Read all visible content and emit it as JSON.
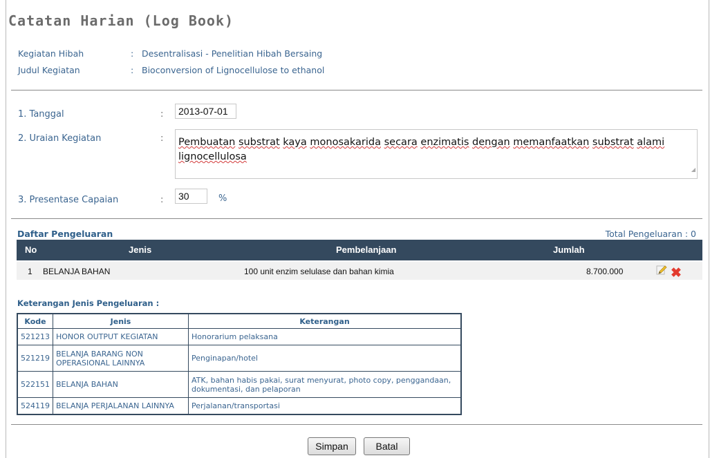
{
  "page": {
    "title": "Catatan Harian (Log Book)"
  },
  "info": {
    "hibah_label": "Kegiatan Hibah",
    "hibah_sep": ":",
    "hibah_value": "Desentralisasi - Penelitian Hibah Bersaing",
    "judul_label": "Judul Kegiatan",
    "judul_sep": ":",
    "judul_value": "Bioconversion of Lignocellulose to ethanol"
  },
  "form": {
    "tanggal_label": "1. Tanggal",
    "tanggal_value": "2013-07-01",
    "uraian_label": "2. Uraian Kegiatan",
    "uraian_words": [
      "Pembuatan",
      "substrat",
      "kaya",
      "monosakarida",
      "secara",
      "enzimatis",
      "dengan",
      "memanfaatkan",
      "substrat",
      "alami",
      "lignocellulosa"
    ],
    "presentase_label": "3. Presentase Capaian",
    "presentase_value": "30",
    "presentase_unit": "%",
    "colon": ":"
  },
  "expenses": {
    "title": "Daftar Pengeluaran",
    "total": "Total Pengeluaran : 0",
    "headers": {
      "no": "No",
      "jenis": "Jenis",
      "pembelanjaan": "Pembelanjaan",
      "jumlah": "Jumlah"
    },
    "rows": [
      {
        "no": "1",
        "jenis": "BELANJA BAHAN",
        "pembelanjaan": "100 unit enzim selulase dan bahan kimia",
        "jumlah": "8.700.000",
        "edit_icon": "pencil-icon",
        "delete_icon": "delete-x-icon"
      }
    ]
  },
  "notes": {
    "title": "Keterangan Jenis Pengeluaran :",
    "headers": {
      "kode": "Kode",
      "jenis": "Jenis",
      "keterangan": "Keterangan"
    },
    "rows": [
      {
        "kode": "521213",
        "jenis": "HONOR OUTPUT KEGIATAN",
        "keterangan": "Honorarium pelaksana"
      },
      {
        "kode": "521219",
        "jenis": "BELANJA BARANG NON OPERASIONAL LAINNYA",
        "keterangan": "Penginapan/hotel"
      },
      {
        "kode": "522151",
        "jenis": "BELANJA BAHAN",
        "keterangan": "ATK, bahan habis pakai, surat menyurat, photo copy, penggandaan, dokumentasi, dan pelaporan"
      },
      {
        "kode": "524119",
        "jenis": "BELANJA PERJALANAN LAINNYA",
        "keterangan": "Perjalanan/transportasi"
      }
    ]
  },
  "buttons": {
    "save": "Simpan",
    "cancel": "Batal"
  },
  "colors": {
    "header_bg": "#34495e",
    "label_blue": "#3b6590",
    "delete_red": "#e33b2f"
  }
}
